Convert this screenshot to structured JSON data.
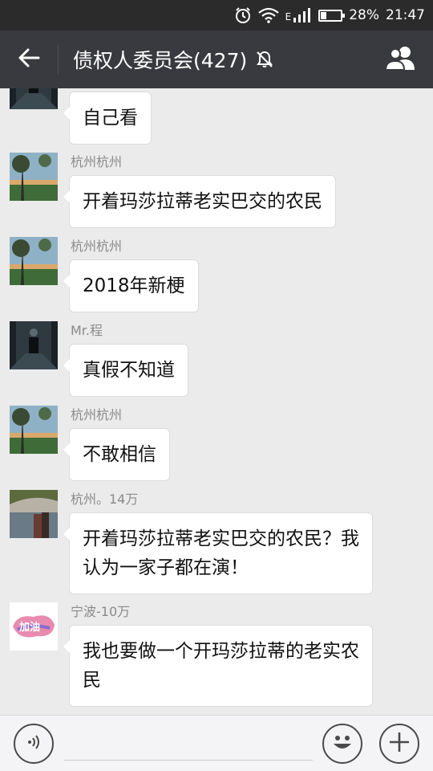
{
  "status_bar": {
    "battery_text": "28%",
    "battery_level": 0.28,
    "time": "21:47",
    "network_label": "E",
    "icons": [
      "alarm-icon",
      "wifi-icon",
      "signal-icon",
      "battery-icon"
    ]
  },
  "header": {
    "title": "债权人委员会(427)",
    "icons": [
      "back-arrow-icon",
      "mute-icon",
      "members-icon"
    ]
  },
  "messages": [
    {
      "sender": "",
      "text": "自己看",
      "avatar": "person-night-avatar"
    },
    {
      "sender": "杭州杭州",
      "text": "开着玛莎拉蒂老实巴交的农民",
      "avatar": "tree-landscape-avatar"
    },
    {
      "sender": "杭州杭州",
      "text": "2018年新梗",
      "avatar": "tree-landscape-avatar"
    },
    {
      "sender": "Mr.程",
      "text": "真假不知道",
      "avatar": "person-night-avatar"
    },
    {
      "sender": "杭州杭州",
      "text": "不敢相信",
      "avatar": "tree-landscape-avatar"
    },
    {
      "sender": "杭州。14万",
      "text_line1": "开着玛莎拉蒂老实巴交的农民？我",
      "text_line2": "认为一家子都在演！",
      "avatar": "lake-couple-avatar"
    },
    {
      "sender": "宁波-10万",
      "text_line1": "我也要做一个开玛莎拉蒂的老实农",
      "text_line2": "民",
      "avatar": "pink-logo-avatar",
      "avatar_text": "加油"
    }
  ],
  "input_bar": {
    "placeholder": "",
    "icons": [
      "voice-icon",
      "emoji-icon",
      "plus-icon"
    ]
  },
  "colors": {
    "header_bg": "#393a3f",
    "status_bg": "#2b2b2b",
    "chat_bg": "#ebebeb",
    "bubble_bg": "#ffffff"
  }
}
